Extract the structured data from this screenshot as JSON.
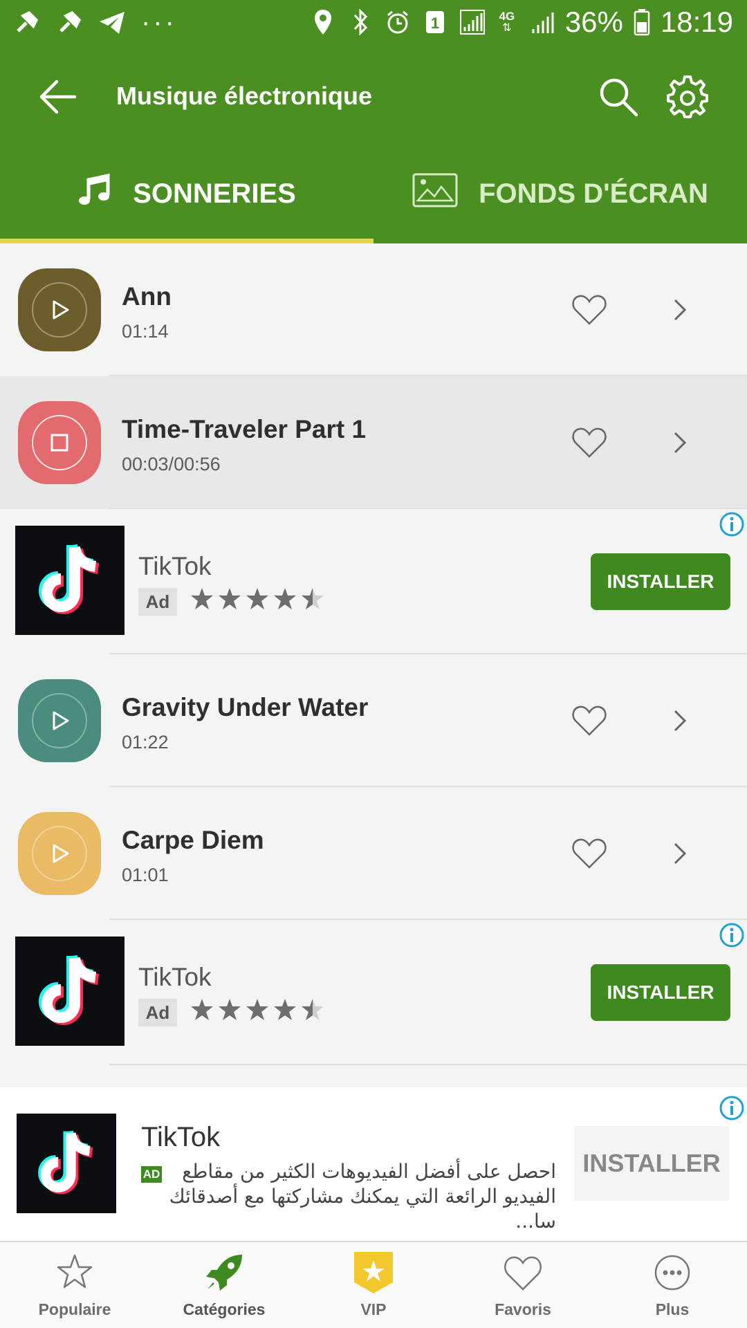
{
  "status_bar": {
    "battery_percent": "36%",
    "time": "18:19",
    "network": "4G",
    "sim_badge": "1",
    "more": "···"
  },
  "app_bar": {
    "title": "Musique électronique",
    "icons": [
      "back-arrow-icon",
      "search-icon",
      "gear-icon"
    ]
  },
  "tabs": [
    {
      "label": "SONNERIES",
      "icon": "music-note-icon",
      "active": true
    },
    {
      "label": "FONDS D'ÉCRAN",
      "icon": "image-icon",
      "active": false
    }
  ],
  "ringtones": [
    {
      "name": "Ann",
      "duration": "01:14",
      "color": "#6b5e2c",
      "state": "play"
    },
    {
      "name": "Time-Traveler Part 1",
      "duration": "00:03/00:56",
      "color": "#e36a6e",
      "state": "stop"
    },
    {
      "name": "Gravity Under Water",
      "duration": "01:22",
      "color": "#4a8c7d",
      "state": "play"
    },
    {
      "name": "Carpe Diem",
      "duration": "01:01",
      "color": "#e9bb65",
      "state": "play"
    }
  ],
  "ads": [
    {
      "name": "TikTok",
      "badge": "Ad",
      "rating": 4.5,
      "button": "INSTALLER"
    },
    {
      "name": "TikTok",
      "badge": "Ad",
      "rating": 4.5,
      "button": "INSTALLER"
    }
  ],
  "banner_ad": {
    "name": "TikTok",
    "badge": "AD",
    "description": "احصل على أفضل الفيديوهات الكثير من مقاطع الفيديو الرائعة التي يمكنك مشاركتها مع أصدقائك سا...",
    "button": "INSTALLER"
  },
  "bottom_nav": [
    {
      "label": "Populaire",
      "icon": "star-outline-icon"
    },
    {
      "label": "Catégories",
      "icon": "rocket-icon",
      "active": true
    },
    {
      "label": "VIP",
      "icon": "vip-badge-icon"
    },
    {
      "label": "Favoris",
      "icon": "heart-outline-icon"
    },
    {
      "label": "Plus",
      "icon": "more-circle-icon"
    }
  ],
  "colors": {
    "primary": "#4b8f22",
    "accent": "#e4d84a",
    "install": "#3f8a1f"
  }
}
